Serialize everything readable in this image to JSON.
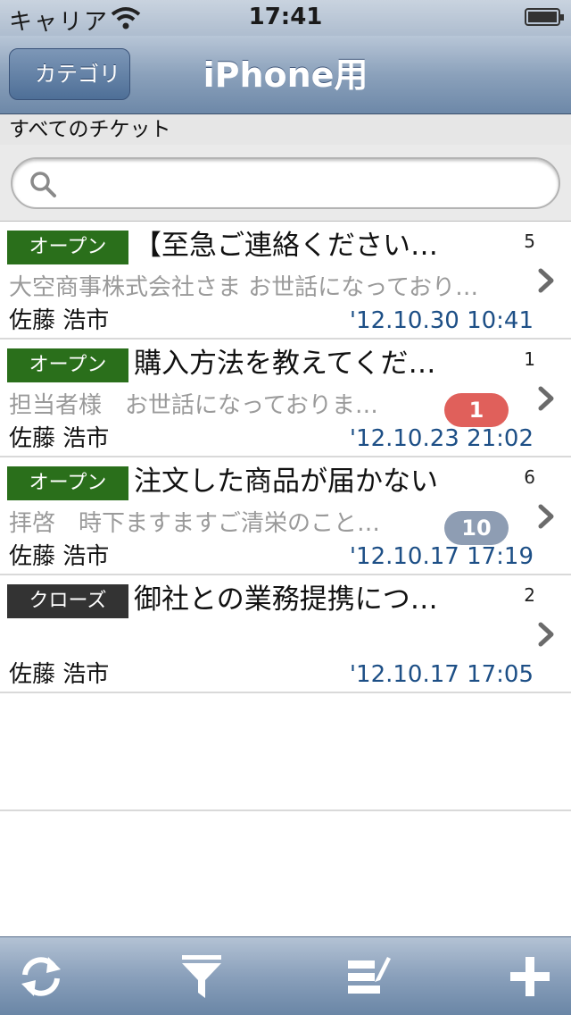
{
  "status_bar": {
    "carrier": "キャリア",
    "time": "17:41"
  },
  "nav": {
    "back_label": "カテゴリ",
    "title": "iPhone用"
  },
  "subheader": "すべてのチケット",
  "search": {
    "placeholder": "",
    "value": ""
  },
  "tickets": [
    {
      "status": "オープン",
      "status_type": "open",
      "title": "【至急ご連絡ください…",
      "count": "5",
      "preview": "大空商事株式会社さま お世話になっており…",
      "unread": "",
      "author": "佐藤 浩市",
      "date": "'12.10.30 10:41"
    },
    {
      "status": "オープン",
      "status_type": "open",
      "title": "購入方法を教えてくだ…",
      "count": "1",
      "preview": "担当者様　お世話になっておりま…",
      "unread": "1",
      "unread_color": "#e0605b",
      "author": "佐藤 浩市",
      "date": "'12.10.23 21:02"
    },
    {
      "status": "オープン",
      "status_type": "open",
      "title": "注文した商品が届かない",
      "count": "6",
      "preview": "拝啓　時下ますますご清栄のこと…",
      "unread": "10",
      "unread_color": "#8e9db3",
      "author": "佐藤 浩市",
      "date": "'12.10.17 17:19"
    },
    {
      "status": "クローズ",
      "status_type": "closed",
      "title": "御社との業務提携につ…",
      "count": "2",
      "preview": "",
      "unread": "",
      "author": "佐藤 浩市",
      "date": "'12.10.17 17:05"
    }
  ],
  "colors": {
    "open": "#2a6f1b",
    "closed": "#333333",
    "date": "#1d4f86"
  },
  "toolbar": {
    "icons": [
      "refresh-icon",
      "filter-icon",
      "edit-list-icon",
      "plus-icon"
    ]
  }
}
